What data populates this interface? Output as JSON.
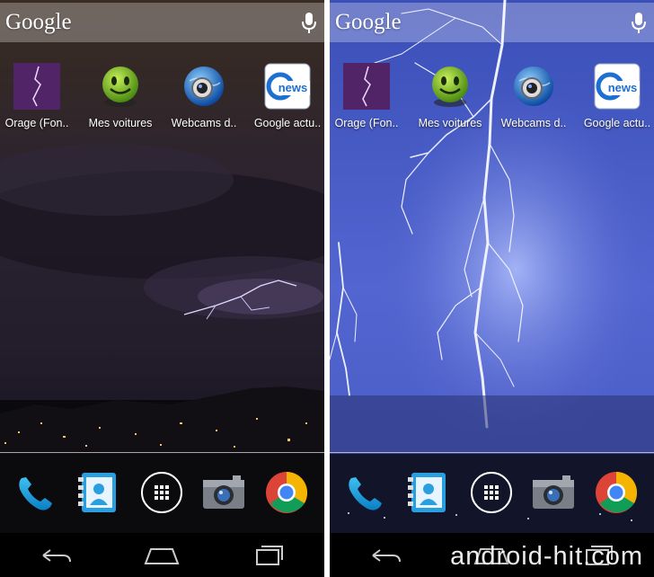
{
  "search": {
    "logo": "Google",
    "mic_icon": "mic-icon"
  },
  "apps": [
    {
      "label": "Orage (Fon..",
      "icon": "lightning-thumbnail-icon"
    },
    {
      "label": "Mes voitures",
      "icon": "green-smiley-car-icon"
    },
    {
      "label": "Webcams d..",
      "icon": "globe-webcam-icon"
    },
    {
      "label": "Google actu..",
      "icon": "google-news-icon"
    }
  ],
  "dock": [
    "phone-icon",
    "contacts-icon",
    "app-drawer-icon",
    "camera-icon",
    "chrome-icon"
  ],
  "nav": [
    "back-icon",
    "home-icon",
    "recents-icon"
  ],
  "watermark": "android-hit.com",
  "colors": {
    "left_sky": "#2a1f25",
    "right_sky": "#4a5ec8",
    "lightning": "#e8e8ff",
    "news_blue": "#1d6fd1"
  }
}
